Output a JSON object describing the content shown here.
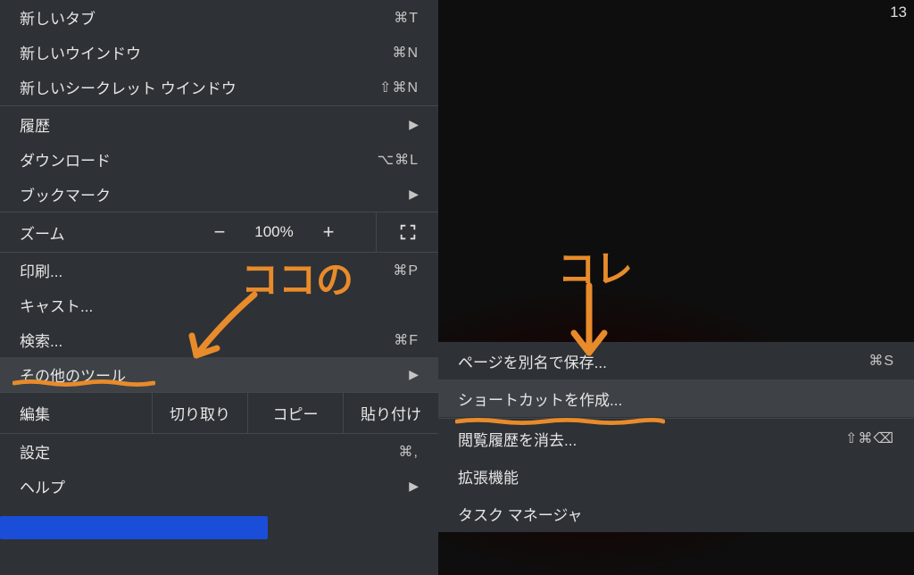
{
  "main_menu": {
    "new_tab": {
      "label": "新しいタブ",
      "shortcut": "⌘T"
    },
    "new_window": {
      "label": "新しいウインドウ",
      "shortcut": "⌘N"
    },
    "new_incognito": {
      "label": "新しいシークレット ウインドウ",
      "shortcut": "⇧⌘N"
    },
    "history": {
      "label": "履歴"
    },
    "downloads": {
      "label": "ダウンロード",
      "shortcut": "⌥⌘L"
    },
    "bookmarks": {
      "label": "ブックマーク"
    },
    "zoom": {
      "label": "ズーム",
      "value": "100%",
      "minus": "−",
      "plus": "+"
    },
    "print": {
      "label": "印刷...",
      "shortcut": "⌘P"
    },
    "cast": {
      "label": "キャスト..."
    },
    "find": {
      "label": "検索...",
      "shortcut": "⌘F"
    },
    "more_tools": {
      "label": "その他のツール"
    },
    "edit": {
      "label": "編集",
      "cut": "切り取り",
      "copy": "コピー",
      "paste": "貼り付け"
    },
    "settings": {
      "label": "設定",
      "shortcut": "⌘,"
    },
    "help": {
      "label": "ヘルプ"
    }
  },
  "submenu": {
    "save_page": {
      "label": "ページを別名で保存...",
      "shortcut": "⌘S"
    },
    "create_shortcut": {
      "label": "ショートカットを作成..."
    },
    "clear_browsing": {
      "label": "閲覧履歴を消去...",
      "shortcut": "⇧⌘⌫"
    },
    "extensions": {
      "label": "拡張機能"
    },
    "task_manager": {
      "label": "タスク マネージャ"
    }
  },
  "annotations": {
    "left_label": "ココの",
    "right_label": "コレ"
  },
  "clock_fragment": "13",
  "colors": {
    "annotation": "#e88b2b",
    "menu_bg": "#2e3135",
    "hover_bg": "#3e4246"
  }
}
